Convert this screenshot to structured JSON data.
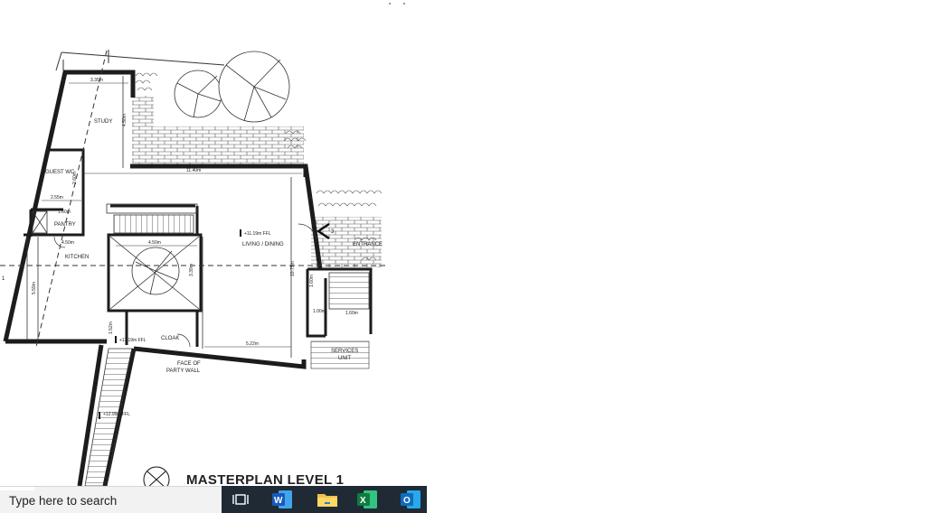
{
  "drawing": {
    "title": "MASTERPLAN LEVEL 1",
    "rooms": {
      "study": "STUDY",
      "guest_wc": "GUEST WC",
      "pantry": "PANTRY",
      "kitchen": "KITCHEN",
      "living_dining": "LIVING / DINING",
      "cloak": "CLOAK",
      "entrance": "ENTRANCE",
      "services_unit": "SERVICES UNIT",
      "face_of_party_wall": "FACE OF PARTY WALL",
      "services_line1": "SERVICES",
      "services_line2": "UNIT",
      "party_line1": "FACE OF",
      "party_line2": "PARTY WALL"
    },
    "dimensions": {
      "study_width": "3.35m",
      "study_depth": "4.50m",
      "overall_width": "11.40m",
      "guest_wc_width": "2.55m",
      "guest_wc_depth": "2.60m",
      "pantry_width": "1.60m",
      "kitchen_width": "4.50m",
      "stair_width": "4.50m",
      "kitchen_depth": "5.59m",
      "living_depth": "10.75m",
      "stair_depth": "3.39m",
      "living_width": "5.22m",
      "cloak_dim": "1.52m",
      "small_dim_a": "1.60m",
      "small_dim_b": "1.00m",
      "core_dim": "1.60m",
      "ffl_living": "+11.19m FFL",
      "ffl_cloak": "+11.19m FFL",
      "ffl_ramp": "+12.99m FFL",
      "section_marker": "3",
      "section_line": "1"
    }
  },
  "taskbar": {
    "search_placeholder": "Type here to search",
    "apps": [
      {
        "name": "task-view",
        "icon": "task-view-icon"
      },
      {
        "name": "word",
        "icon": "word-icon",
        "letter": "W",
        "color": "#2b579a"
      },
      {
        "name": "file-explorer",
        "icon": "folder-icon",
        "color": "#f0c14b"
      },
      {
        "name": "excel",
        "icon": "excel-icon",
        "letter": "X",
        "color": "#217346"
      },
      {
        "name": "outlook",
        "icon": "outlook-icon",
        "letter": "O",
        "color": "#0f6cbd"
      }
    ]
  }
}
